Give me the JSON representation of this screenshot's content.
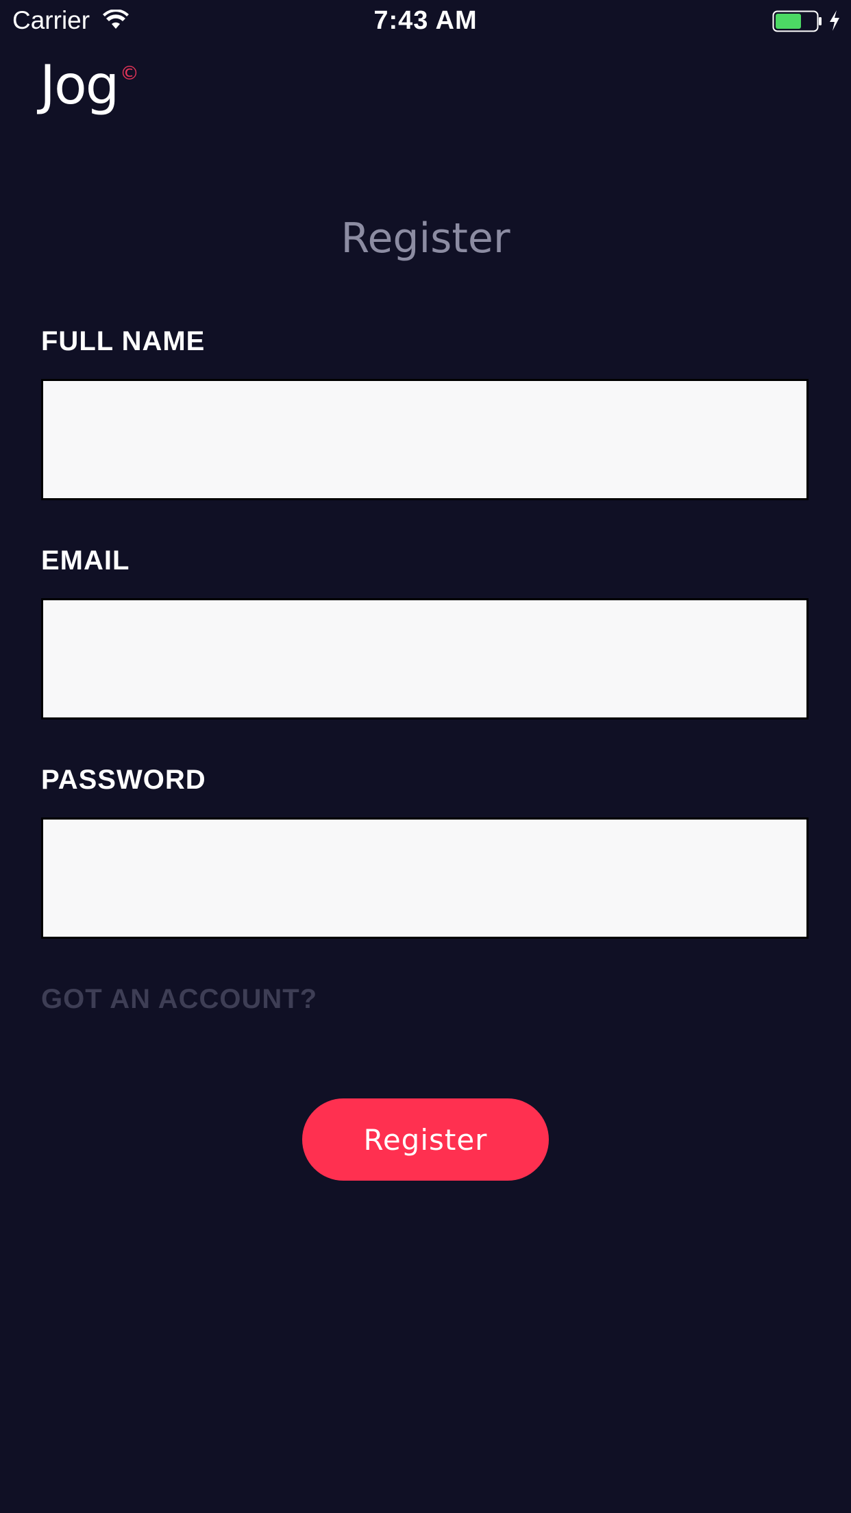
{
  "status_bar": {
    "carrier": "Carrier",
    "time": "7:43 AM",
    "battery_color": "#4cd964"
  },
  "brand": {
    "logo_text": "Jog",
    "logo_mark": "©",
    "accent_color": "#e8355a"
  },
  "page": {
    "title": "Register",
    "background": "#101025"
  },
  "form": {
    "full_name": {
      "label": "FULL NAME",
      "value": "",
      "placeholder": ""
    },
    "email": {
      "label": "EMAIL",
      "value": "",
      "placeholder": ""
    },
    "password": {
      "label": "PASSWORD",
      "value": "",
      "placeholder": ""
    },
    "account_link": "GOT AN ACCOUNT?",
    "submit_label": "Register",
    "submit_color": "#ff3050"
  },
  "icons": [
    "wifi-icon",
    "battery-icon",
    "charging-bolt-icon"
  ]
}
